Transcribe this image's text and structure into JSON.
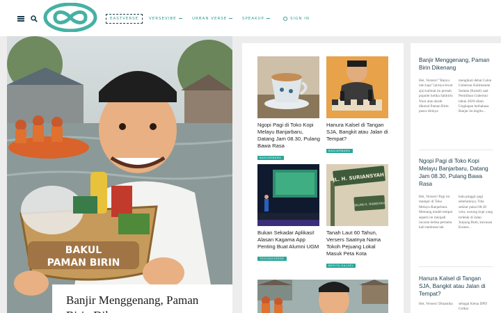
{
  "nav": {
    "items": [
      "EASTVERSE",
      "VERSEVIBE",
      "URBAN VERSE",
      "SPEAKUP",
      "SIGN IN"
    ]
  },
  "hero": {
    "banner_text_line1": "BAKUL",
    "banner_text_line2": "PAMAN BIRIN",
    "title": "Banjir Menggenang, Paman Birin Dikenang"
  },
  "grid": {
    "cards": [
      {
        "title": "Ngopi Pagi di Toko Kopi Melayu Banjarbaru, Datang Jam 08.30, Pulang Bawa Rasa",
        "tag": "BANJARBARU"
      },
      {
        "title": "Hanura Kalsel di Tangan SJA, Bangkit atau Jalan di Tempat?",
        "tag": "BANJARBARU"
      },
      {
        "title": "Bukan Sekadar Aplikasi! Alasan Kagama App Penting Buat Alumni UGM",
        "tag": "TECHNOVERSE"
      },
      {
        "title": "Tanah Laut 60 Tahun, Versers Saatnya Nama Tokoh Pejuang Lokal Masuk Peta Kota",
        "tag": "BERITA KALSEL"
      }
    ],
    "signpost_line1": "JL. H. SURIANSYAH",
    "signpost_line2": "JALAN H. RIANSYAH"
  },
  "sidebar": {
    "items": [
      {
        "title": "Banjir Menggenang, Paman Birin Dikenang",
        "left": "Hei, Versers! \"Banyu lalu haja\" (airnya lewat aja) kalimat itu pernah populer ketika Sahbirin Noor atau akrab dikenal Paman Birin pasca dirinya",
        "right": "mengikuti debat Calon Gubernur Kalimantan Selatan (Kalsel) saat Pemilihan Gubernur tahun 2020 silam. Ungkapan berbahasa Banjar itu begitu..."
      },
      {
        "title": "Ngopi Pagi di Toko Kopi Melayu Banjarbaru, Datang Jam 08.30, Pulang Bawa Rasa",
        "left": "Hei, Versers! Pagi ini mampir di Toko Melayu Banjarbaru. Memang model tempat seperti ini menjadi incaran ketika pertama kali melintasi tak",
        "right": "kala pinggir pagi sebelumnya. Tiba sekitar pukul 08.30 wita, warung kopi yang terletak di Jalan Junjung Buih, kawasan Komet..."
      },
      {
        "title": "Hanura Kalsel di Tangan SJA, Bangkit atau Jalan di Tempat?",
        "left": "Hei, Versers! Dinamika",
        "right": "sebagai Ketua DPD Golkar"
      }
    ]
  }
}
